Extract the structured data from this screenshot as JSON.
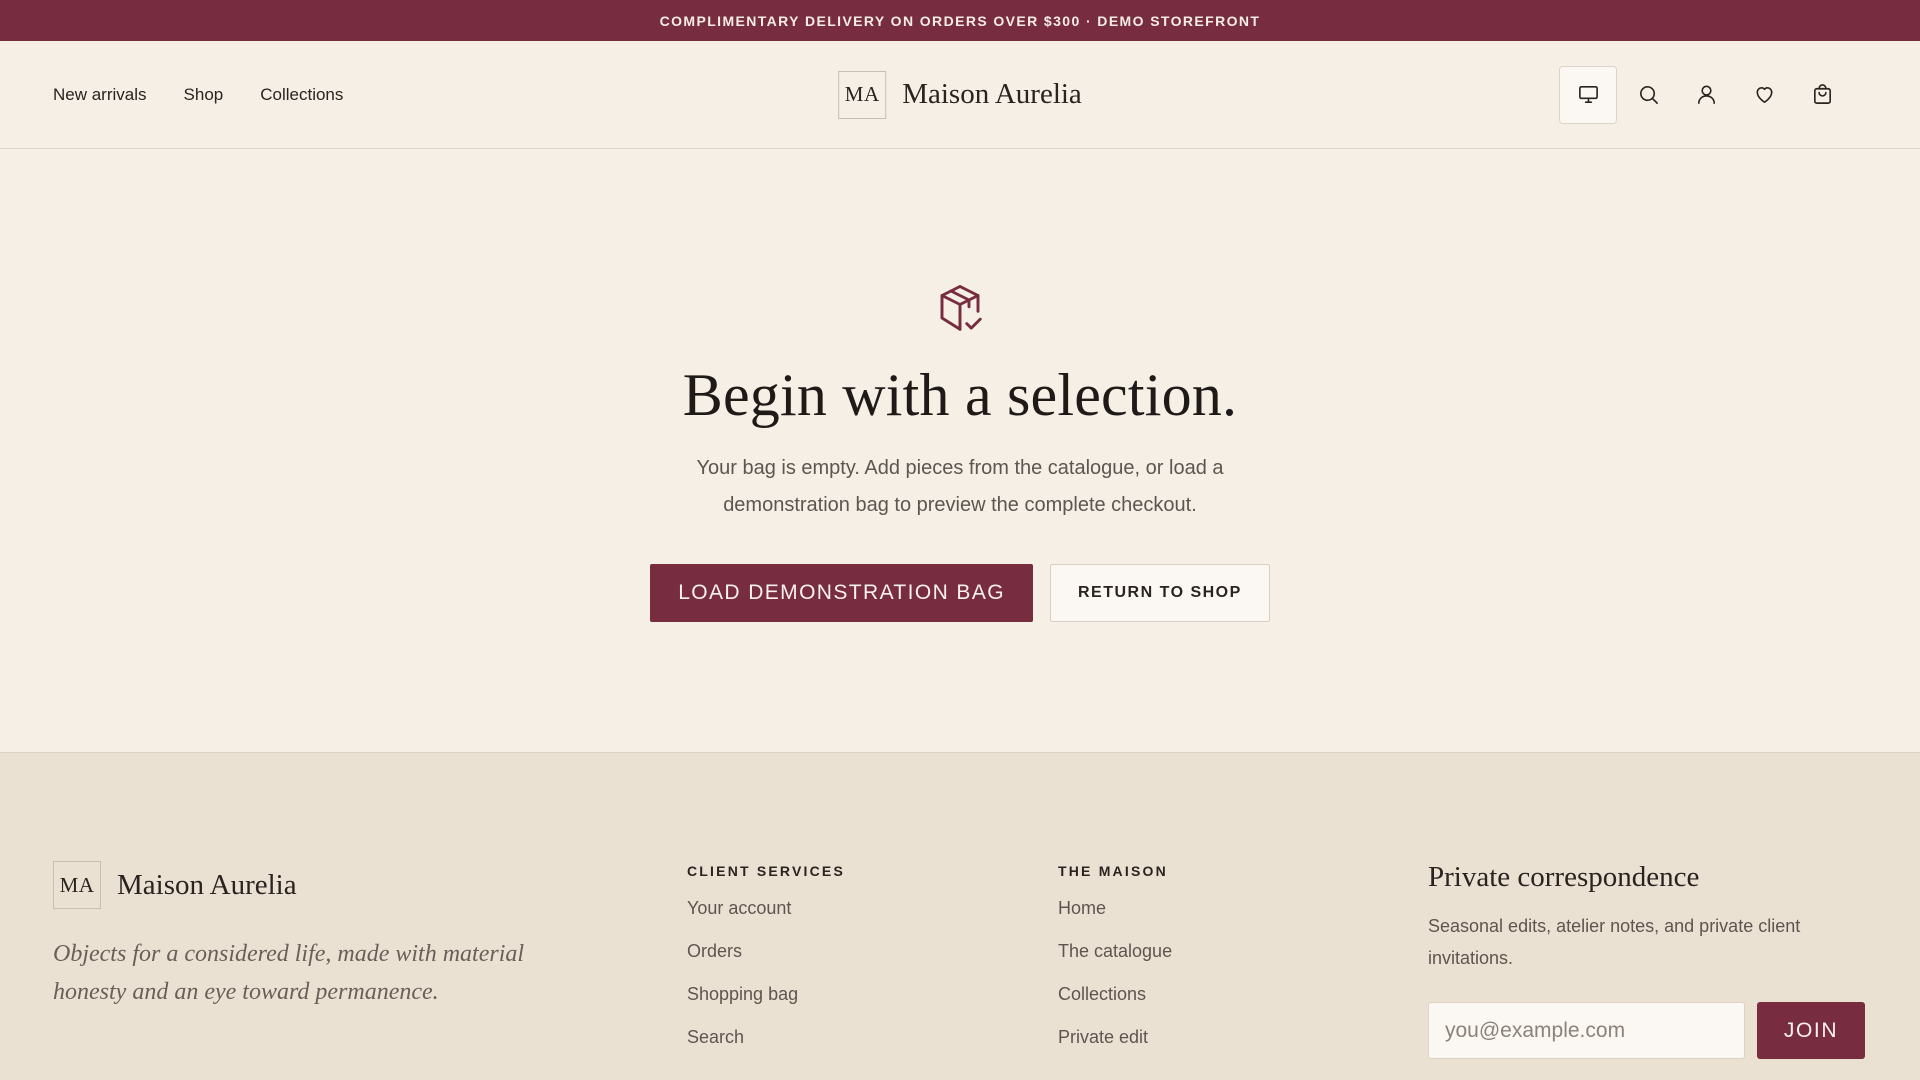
{
  "announcement": "COMPLIMENTARY DELIVERY ON ORDERS OVER $300 · DEMO STOREFRONT",
  "nav": [
    "New arrivals",
    "Shop",
    "Collections"
  ],
  "brand": {
    "monogram": "MA",
    "name": "Maison Aurelia"
  },
  "header_icons": [
    "monitor-icon",
    "search-icon",
    "user-icon",
    "heart-icon",
    "bag-icon"
  ],
  "hero": {
    "icon": "package-check-icon",
    "title": "Begin with a selection.",
    "text": "Your bag is empty. Add pieces from the catalogue, or load a demonstration bag to preview the complete checkout.",
    "primary_label": "LOAD DEMONSTRATION BAG",
    "secondary_label": "RETURN TO SHOP"
  },
  "footer": {
    "tagline": "Objects for a considered life, made with material honesty and an eye toward permanence.",
    "client_services": {
      "heading": "CLIENT SERVICES",
      "links": [
        "Your account",
        "Orders",
        "Shopping bag",
        "Search"
      ]
    },
    "the_maison": {
      "heading": "THE MAISON",
      "links": [
        "Home",
        "The catalogue",
        "Collections",
        "Private edit"
      ]
    },
    "newsletter": {
      "title": "Private correspondence",
      "text": "Seasonal edits, atelier notes, and private client invitations.",
      "placeholder": "you@example.com",
      "button": "JOIN"
    }
  },
  "colors": {
    "accent": "#772c40",
    "background": "#f5efe6",
    "footer_bg": "#ebe1d3"
  }
}
